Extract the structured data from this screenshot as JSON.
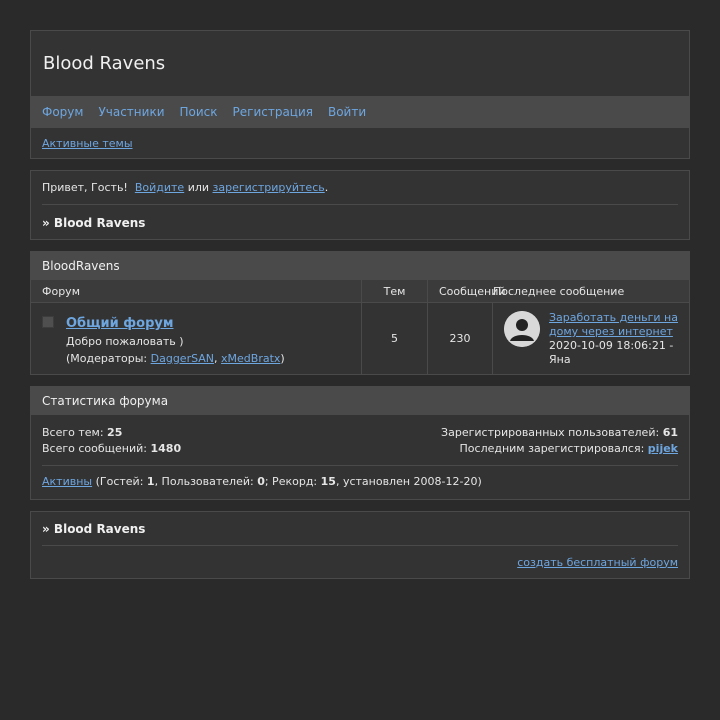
{
  "header": {
    "site_title": "Blood Ravens",
    "nav": [
      "Форум",
      "Участники",
      "Поиск",
      "Регистрация",
      "Войти"
    ],
    "active_topics": "Активные темы"
  },
  "welcome": {
    "greeting": "Привет, Гость!  ",
    "login_link": "Войдите",
    "or_text": " или ",
    "register_link": "зарегистрируйтесь",
    "end": ".",
    "breadcrumb": "» Blood Ravens"
  },
  "forums": {
    "category": "BloodRavens",
    "columns": {
      "forum": "Форум",
      "topics": "Тем",
      "posts": "Сообщений",
      "last_post": "Последнее сообщение"
    },
    "rows": [
      {
        "name": "Общий форум",
        "description": "Добро пожаловать )",
        "moderators_label": "(Модераторы: ",
        "moderator1": "DaggerSAN",
        "separator": ", ",
        "moderator2": "xMedBratx",
        "moderators_end": ")",
        "topics": "5",
        "posts": "230",
        "last_post_title": "Заработать деньги на дому через интернет",
        "last_post_meta": "2020-10-09 18:06:21 - Яна",
        "avatar_icon": "user-silhouette-icon"
      }
    ]
  },
  "stats": {
    "title": "Статистика форума",
    "total_topics_label": "Всего тем: ",
    "total_topics": "25",
    "total_posts_label": "Всего сообщений: ",
    "total_posts": "1480",
    "registered_label": "Зарегистрированных пользователей: ",
    "registered": "61",
    "last_registered_label": "Последним зарегистрировался: ",
    "last_registered": "pijek",
    "active_link": "Активны",
    "guests_label": " (Гостей: ",
    "guests": "1",
    "users_label": ", Пользователей: ",
    "users": "0",
    "record_label": "; Рекорд: ",
    "record": "15",
    "record_date_text": ", установлен 2008-12-20)"
  },
  "footer": {
    "breadcrumb": "» Blood Ravens",
    "credits": "создать бесплатный форум"
  },
  "colors": {
    "background": "#2a2a2a",
    "panel": "#333333",
    "bar": "#4a4a4a",
    "link": "#6ea6e0"
  }
}
